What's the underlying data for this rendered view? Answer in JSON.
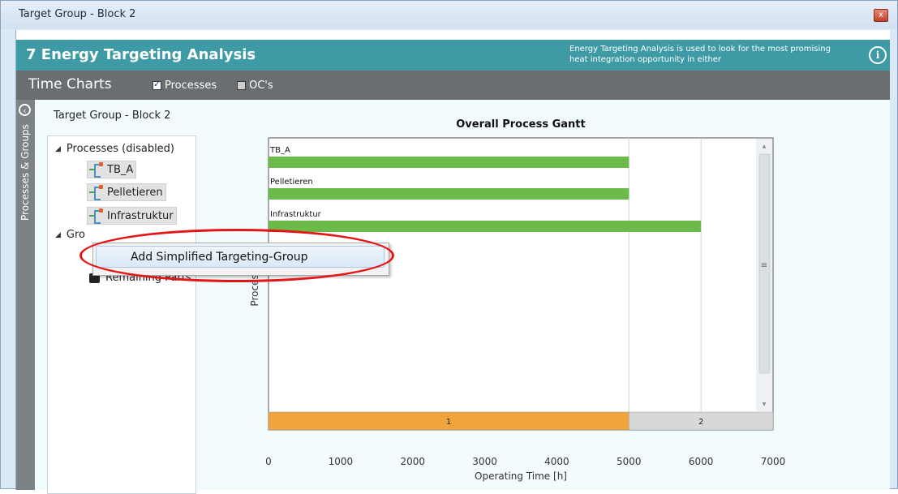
{
  "window": {
    "title": "Target Group - Block 2",
    "close_label": "x"
  },
  "header": {
    "title": "7 Energy Targeting Analysis",
    "description": "Energy Targeting Analysis is used to look for the most promising heat integration opportunity in either",
    "info_icon": "info-icon"
  },
  "toolbar": {
    "title": "Time Charts",
    "checkboxes": [
      {
        "label": "Processes",
        "checked": true
      },
      {
        "label": "OC's",
        "checked": false
      }
    ]
  },
  "sidebar": {
    "tab_label": "Processes & Groups",
    "collapse_icon": "collapse-left-icon"
  },
  "panel": {
    "group_title": "Target Group - Block 2",
    "tree": {
      "processes_node": "Processes (disabled)",
      "processes": [
        "TB_A",
        "Pelletieren",
        "Infrastruktur"
      ],
      "groups_node": "Gro",
      "groups": [
        "Remaining Parts"
      ]
    }
  },
  "context_menu": {
    "items": [
      "Add Simplified Targeting-Group"
    ]
  },
  "colors": {
    "accent": "#3e9ba6",
    "bar": "#6bba4a",
    "phase1": "#f0a43a",
    "phase2": "#d8d8d8",
    "highlight": "#e51417"
  },
  "chart_data": {
    "type": "gantt",
    "title": "Overall Process Gantt",
    "xlabel": "Operating Time [h]",
    "ylabel": "Processes",
    "xlim": [
      0,
      7000
    ],
    "xticks": [
      0,
      1000,
      2000,
      3000,
      4000,
      5000,
      6000,
      7000
    ],
    "bars": [
      {
        "name": "TB_A",
        "start": 0,
        "end": 5000
      },
      {
        "name": "Pelletieren",
        "start": 0,
        "end": 5000
      },
      {
        "name": "Infrastruktur",
        "start": 0,
        "end": 6000
      }
    ],
    "phases": [
      {
        "label": "1",
        "start": 0,
        "end": 5000
      },
      {
        "label": "2",
        "start": 5000,
        "end": 7000
      }
    ],
    "vlines": [
      5000,
      6000
    ]
  }
}
